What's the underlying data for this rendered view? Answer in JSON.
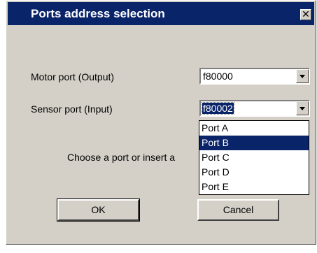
{
  "dialog": {
    "title": "Ports address selection",
    "close_glyph": "✕"
  },
  "motor_port": {
    "label": "Motor port (Output)",
    "value": "f80000"
  },
  "sensor_port": {
    "label": "Sensor port (Input)",
    "value": "f80002",
    "options": [
      "Port A",
      "Port B",
      "Port C",
      "Port D",
      "Port E"
    ],
    "highlighted_option": "Port B"
  },
  "hint": "Choose a port or insert a",
  "buttons": {
    "ok": "OK",
    "cancel": "Cancel"
  },
  "colors": {
    "titlebar": "#0a246a",
    "face": "#d4d0c8",
    "highlight": "#0a246a"
  }
}
